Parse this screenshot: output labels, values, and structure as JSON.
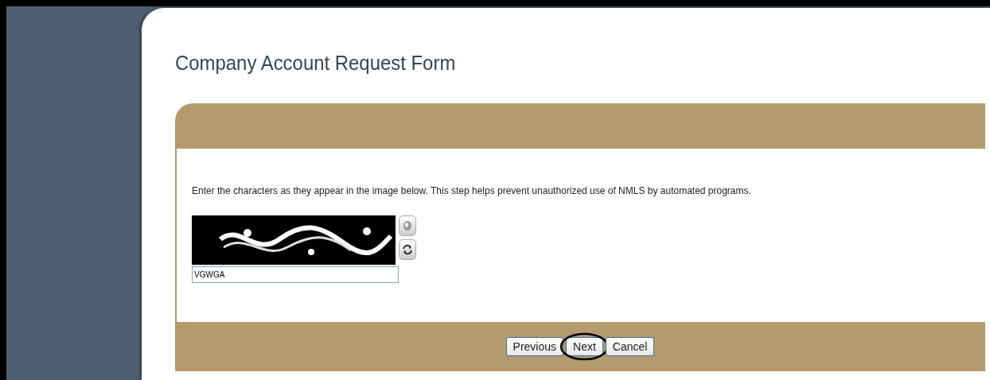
{
  "page": {
    "title": "Company Account Request Form"
  },
  "captcha": {
    "instructions": "Enter the characters as they appear in the image below. This step helps prevent unauthorized use of NMLS by automated programs.",
    "value": "VGWGA"
  },
  "buttons": [
    {
      "label": "Previous",
      "circled": false
    },
    {
      "label": "Next",
      "circled": true
    },
    {
      "label": "Cancel",
      "circled": false
    }
  ]
}
